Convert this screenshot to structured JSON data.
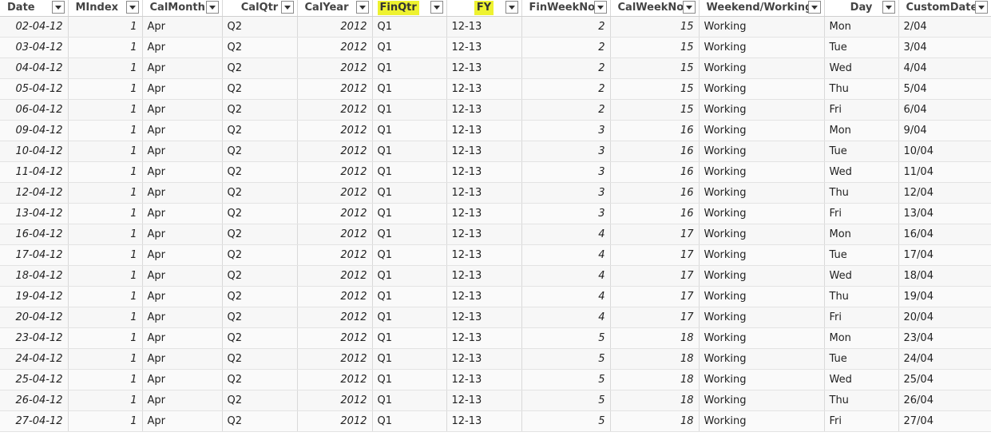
{
  "columns": [
    {
      "key": "Date",
      "label": "Date",
      "align": "italic-right",
      "highlight": false
    },
    {
      "key": "MIndex",
      "label": "MIndex",
      "align": "num",
      "highlight": false
    },
    {
      "key": "CalMonth",
      "label": "CalMonth",
      "align": "text",
      "highlight": false
    },
    {
      "key": "CalQtr",
      "label": "CalQtr",
      "align": "text",
      "highlight": false
    },
    {
      "key": "CalYear",
      "label": "CalYear",
      "align": "num",
      "highlight": false
    },
    {
      "key": "FinQtr",
      "label": "FinQtr",
      "align": "text",
      "highlight": true
    },
    {
      "key": "FY",
      "label": "FY",
      "align": "text",
      "highlight": true
    },
    {
      "key": "FinWeekNo",
      "label": "FinWeekNo",
      "align": "num",
      "highlight": false
    },
    {
      "key": "CalWeekNo",
      "label": "CalWeekNo",
      "align": "num",
      "highlight": false
    },
    {
      "key": "WeekendWorking",
      "label": "Weekend/Working",
      "align": "text",
      "highlight": false
    },
    {
      "key": "Day",
      "label": "Day",
      "align": "text",
      "highlight": false
    },
    {
      "key": "CustomDate",
      "label": "CustomDate",
      "align": "text",
      "highlight": false
    }
  ],
  "rows": [
    [
      "02-04-12",
      "1",
      "Apr",
      "Q2",
      "2012",
      "Q1",
      "12-13",
      "2",
      "15",
      "Working",
      "Mon",
      "2/04"
    ],
    [
      "03-04-12",
      "1",
      "Apr",
      "Q2",
      "2012",
      "Q1",
      "12-13",
      "2",
      "15",
      "Working",
      "Tue",
      "3/04"
    ],
    [
      "04-04-12",
      "1",
      "Apr",
      "Q2",
      "2012",
      "Q1",
      "12-13",
      "2",
      "15",
      "Working",
      "Wed",
      "4/04"
    ],
    [
      "05-04-12",
      "1",
      "Apr",
      "Q2",
      "2012",
      "Q1",
      "12-13",
      "2",
      "15",
      "Working",
      "Thu",
      "5/04"
    ],
    [
      "06-04-12",
      "1",
      "Apr",
      "Q2",
      "2012",
      "Q1",
      "12-13",
      "2",
      "15",
      "Working",
      "Fri",
      "6/04"
    ],
    [
      "09-04-12",
      "1",
      "Apr",
      "Q2",
      "2012",
      "Q1",
      "12-13",
      "3",
      "16",
      "Working",
      "Mon",
      "9/04"
    ],
    [
      "10-04-12",
      "1",
      "Apr",
      "Q2",
      "2012",
      "Q1",
      "12-13",
      "3",
      "16",
      "Working",
      "Tue",
      "10/04"
    ],
    [
      "11-04-12",
      "1",
      "Apr",
      "Q2",
      "2012",
      "Q1",
      "12-13",
      "3",
      "16",
      "Working",
      "Wed",
      "11/04"
    ],
    [
      "12-04-12",
      "1",
      "Apr",
      "Q2",
      "2012",
      "Q1",
      "12-13",
      "3",
      "16",
      "Working",
      "Thu",
      "12/04"
    ],
    [
      "13-04-12",
      "1",
      "Apr",
      "Q2",
      "2012",
      "Q1",
      "12-13",
      "3",
      "16",
      "Working",
      "Fri",
      "13/04"
    ],
    [
      "16-04-12",
      "1",
      "Apr",
      "Q2",
      "2012",
      "Q1",
      "12-13",
      "4",
      "17",
      "Working",
      "Mon",
      "16/04"
    ],
    [
      "17-04-12",
      "1",
      "Apr",
      "Q2",
      "2012",
      "Q1",
      "12-13",
      "4",
      "17",
      "Working",
      "Tue",
      "17/04"
    ],
    [
      "18-04-12",
      "1",
      "Apr",
      "Q2",
      "2012",
      "Q1",
      "12-13",
      "4",
      "17",
      "Working",
      "Wed",
      "18/04"
    ],
    [
      "19-04-12",
      "1",
      "Apr",
      "Q2",
      "2012",
      "Q1",
      "12-13",
      "4",
      "17",
      "Working",
      "Thu",
      "19/04"
    ],
    [
      "20-04-12",
      "1",
      "Apr",
      "Q2",
      "2012",
      "Q1",
      "12-13",
      "4",
      "17",
      "Working",
      "Fri",
      "20/04"
    ],
    [
      "23-04-12",
      "1",
      "Apr",
      "Q2",
      "2012",
      "Q1",
      "12-13",
      "5",
      "18",
      "Working",
      "Mon",
      "23/04"
    ],
    [
      "24-04-12",
      "1",
      "Apr",
      "Q2",
      "2012",
      "Q1",
      "12-13",
      "5",
      "18",
      "Working",
      "Tue",
      "24/04"
    ],
    [
      "25-04-12",
      "1",
      "Apr",
      "Q2",
      "2012",
      "Q1",
      "12-13",
      "5",
      "18",
      "Working",
      "Wed",
      "25/04"
    ],
    [
      "26-04-12",
      "1",
      "Apr",
      "Q2",
      "2012",
      "Q1",
      "12-13",
      "5",
      "18",
      "Working",
      "Thu",
      "26/04"
    ],
    [
      "27-04-12",
      "1",
      "Apr",
      "Q2",
      "2012",
      "Q1",
      "12-13",
      "5",
      "18",
      "Working",
      "Fri",
      "27/04"
    ]
  ],
  "colors": {
    "highlight": "#eef230",
    "border": "#d9d9d9"
  },
  "icons": {
    "filter": "chevron-down-icon"
  }
}
